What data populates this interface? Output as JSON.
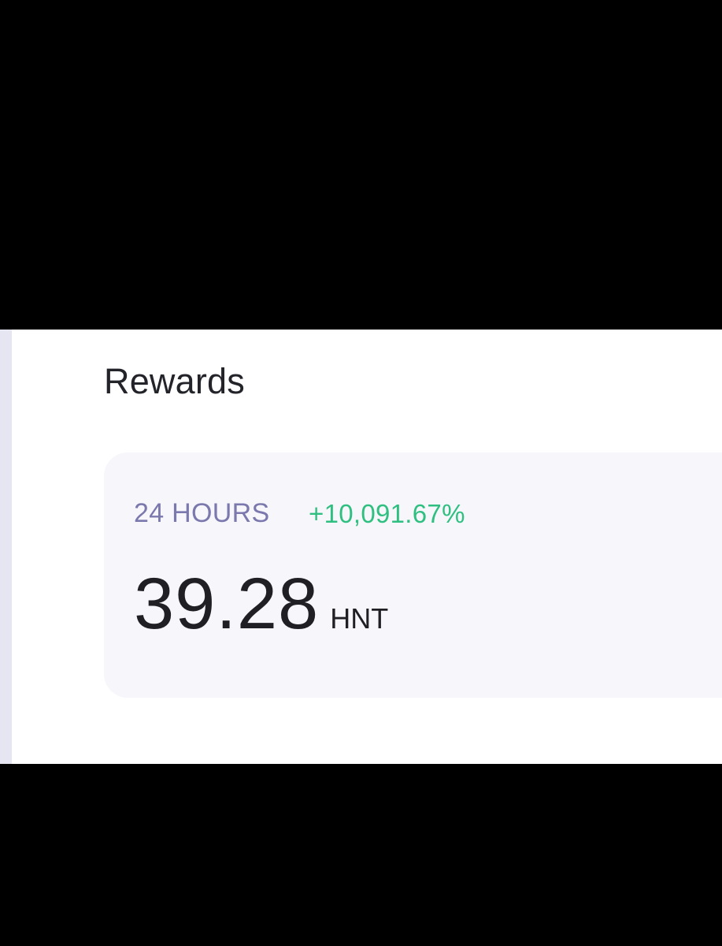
{
  "section": {
    "title": "Rewards"
  },
  "rewards_card": {
    "period_label": "24 HOURS",
    "change": "+10,091.67%",
    "amount": "39.28",
    "unit": "HNT"
  },
  "colors": {
    "period_label": "#7a78ad",
    "change_positive": "#2fbf80",
    "card_background": "#f6f6fb",
    "text_primary": "#1f1f24"
  }
}
